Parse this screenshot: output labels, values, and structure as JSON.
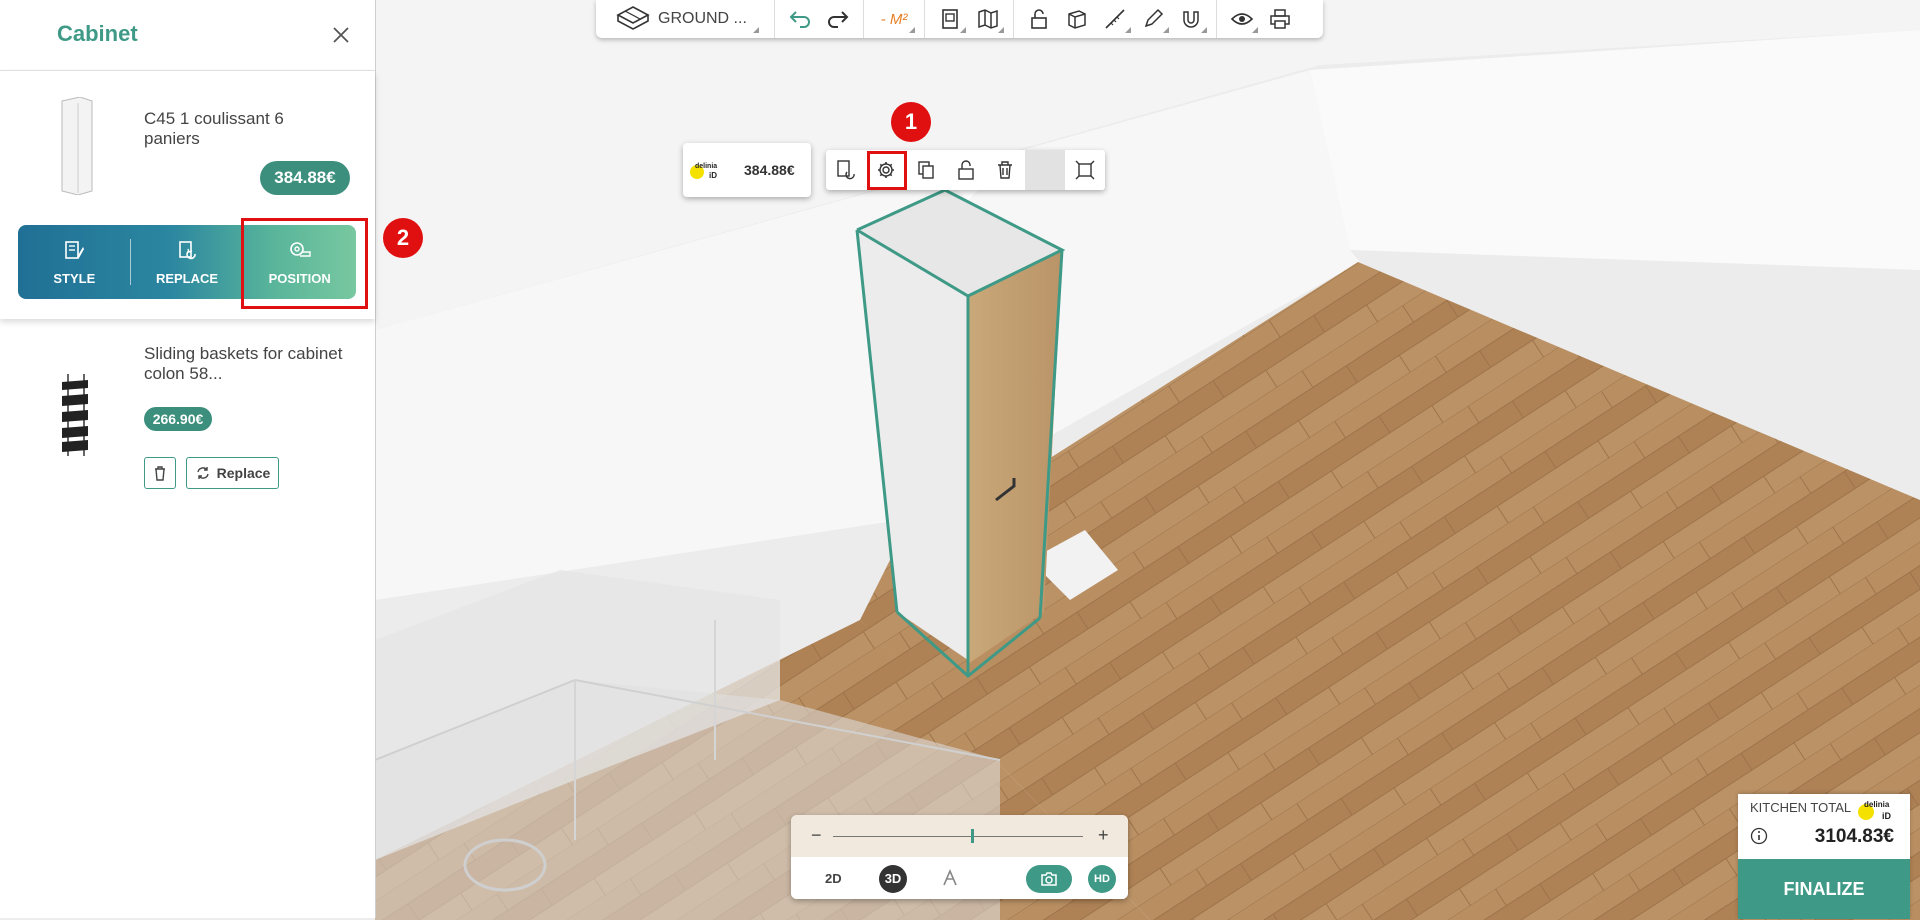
{
  "toolbar": {
    "floor_label": "GROUND ...",
    "area_label": "- M²",
    "icons": [
      "floor-plan-icon",
      "undo-icon",
      "redo-icon",
      "area-icon",
      "document-icon",
      "map-icon",
      "lock-icon",
      "cube-icon",
      "ruler-icon",
      "pencil-icon",
      "magnet-icon",
      "eye-icon",
      "print-icon"
    ]
  },
  "panel": {
    "title": "Cabinet",
    "items": [
      {
        "name": "C45 1 coulissant 6 paniers",
        "price": "384.88€"
      },
      {
        "name": "Sliding baskets for cabinet colon 58...",
        "price": "266.90€",
        "replace_label": "Replace"
      }
    ],
    "actions": [
      {
        "label": "STYLE",
        "icon": "style-icon"
      },
      {
        "label": "REPLACE",
        "icon": "replace-icon"
      },
      {
        "label": "POSITION",
        "icon": "position-icon"
      }
    ]
  },
  "annotations": {
    "marker1": "1",
    "marker2": "2"
  },
  "selection": {
    "price": "384.88€",
    "brand": "delinia iD",
    "tools": [
      "swap-icon",
      "settings-icon",
      "duplicate-icon",
      "unlock-icon",
      "trash-icon",
      "color-swatch",
      "resize-icon"
    ]
  },
  "view_controls": {
    "zoom_minus": "−",
    "zoom_plus": "+",
    "zoom_level": 0.55,
    "btn_2d": "2D",
    "btn_3d": "3D",
    "btn_hd": "HD"
  },
  "total": {
    "label": "KITCHEN TOTAL",
    "brand": "delinia iD",
    "amount": "3104.83€",
    "finalize_label": "FINALIZE"
  },
  "colors": {
    "accent": "#3e9a86",
    "highlight": "#e01010",
    "floor": "#b48a5e"
  }
}
